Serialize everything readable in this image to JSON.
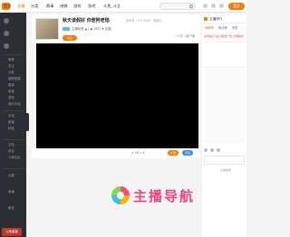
{
  "topnav": {
    "items": [
      "首页",
      "直播",
      "分类",
      "赛事",
      "視頻",
      "游戏",
      "鱼吧",
      "斗鱼_斗丑"
    ],
    "search_placeholder": "",
    "login_label": "登录"
  },
  "sidebar": {
    "items": [
      "推荐",
      "关注",
      "分类",
      "视频直播",
      "赛事",
      "电竞",
      "游戏",
      "娱乐天地",
      "手游",
      "颜值",
      "科技",
      "文化",
      "综合",
      "斗鱼社区",
      "大赛",
      "鱼塘",
      "更多"
    ],
    "bottom_label": "斗鱼直播"
  },
  "room": {
    "title": "秋天该假好 你若阿老陆",
    "room_id": "房间号：6715328 · 直播中",
    "line2": "主播标签  ▲1  ◆ 28万  ♦ 回放",
    "badge": "关注",
    "header_right": "☆分享  ◇客户端"
  },
  "toolbar": {
    "text1": "◎ 44  ◇ 6",
    "gift_label": "礼物",
    "gift2_label": "背包"
  },
  "watermark": {
    "text": "主播导航"
  },
  "right_panel": {
    "header": "主播排行",
    "tabs": [
      "贡献榜",
      "粉丝榜",
      "贵宾"
    ],
    "notice": "系统提示:禁止刷屏广告·文明聊天",
    "footer": "主播推荐"
  },
  "colors": {
    "accent": "#ff7800",
    "sidebar_bg": "#2b2e33",
    "watermark": "#f0437b"
  }
}
